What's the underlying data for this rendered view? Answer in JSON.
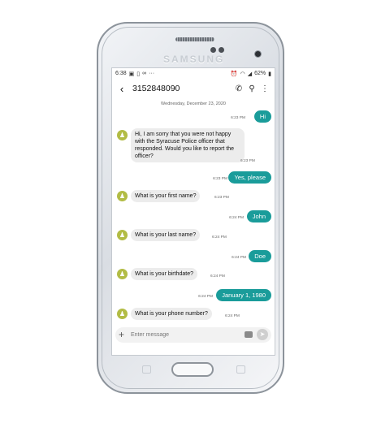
{
  "device": {
    "brand": "SAMSUNG"
  },
  "status_bar": {
    "time": "6:38",
    "battery": "62%",
    "left_icons": [
      "image-icon",
      "sim-icon",
      "voicemail-icon",
      "more-icon"
    ],
    "right_icons": [
      "alarm-icon",
      "wifi-icon",
      "signal-icon",
      "battery-icon"
    ]
  },
  "header": {
    "back_icon": "back-arrow-icon",
    "title": "3152848090",
    "call_icon": "phone-icon",
    "search_icon": "search-icon",
    "menu_icon": "more-vert-icon"
  },
  "thread": {
    "date": "Wednesday, December 23, 2020",
    "messages": [
      {
        "dir": "out",
        "text": "Hi",
        "time": "6:23 PM"
      },
      {
        "dir": "in",
        "text": "Hi, I am sorry that you were not happy with the Syracuse Police officer that responded.  Would you like to report the officer?",
        "time": "6:23 PM"
      },
      {
        "dir": "out",
        "text": "Yes, please",
        "time": "6:23 PM"
      },
      {
        "dir": "in",
        "text": "What is your first name?",
        "time": "6:23 PM"
      },
      {
        "dir": "out",
        "text": "John",
        "time": "6:24 PM"
      },
      {
        "dir": "in",
        "text": "What is your last name?",
        "time": "6:24 PM"
      },
      {
        "dir": "out",
        "text": "Doe",
        "time": "6:24 PM"
      },
      {
        "dir": "in",
        "text": "What is your birthdate?",
        "time": "6:24 PM"
      },
      {
        "dir": "out",
        "text": "January 1, 1980",
        "time": "6:24 PM"
      },
      {
        "dir": "in",
        "text": "What is your phone number?",
        "time": "6:24 PM"
      }
    ]
  },
  "composer": {
    "placeholder": "Enter message",
    "value": ""
  },
  "colors": {
    "outgoing_bubble": "#1a9c9a",
    "incoming_bubble": "#ececec",
    "avatar": "#b2bc45"
  }
}
